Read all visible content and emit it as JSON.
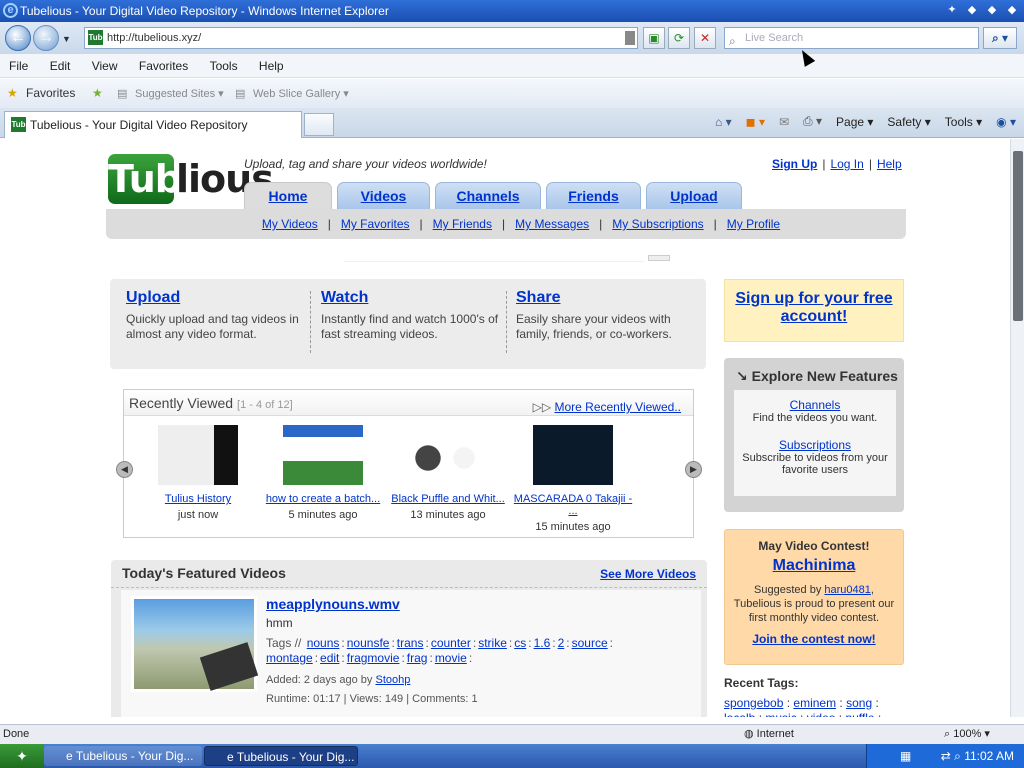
{
  "window": {
    "title": "Tubelious - Your Digital Video Repository - Windows Internet Explorer"
  },
  "browser": {
    "address": "http://tubelious.xyz/",
    "search_placeholder": "Live Search",
    "menu": [
      "File",
      "Edit",
      "View",
      "Favorites",
      "Tools",
      "Help"
    ],
    "favorites_bar": {
      "favorites": "Favorites",
      "suggested": "Suggested Sites ▾",
      "webslice": "Web Slice Gallery ▾"
    },
    "tab_title": "Tubelious - Your Digital Video Repository",
    "commands": {
      "page": "Page ▾",
      "safety": "Safety ▾",
      "tools": "Tools ▾"
    }
  },
  "site": {
    "logo_left": "Tube",
    "logo_right": "lious",
    "tagline": "Upload, tag and share your videos worldwide!",
    "toplinks": {
      "signup": "Sign Up",
      "login": "Log In",
      "help": "Help"
    },
    "tabs": [
      "Home",
      "Videos",
      "Channels",
      "Friends",
      "Upload"
    ],
    "subnav": [
      "My Videos",
      "My Favorites",
      "My Friends",
      "My Messages",
      "My Subscriptions",
      "My Profile"
    ]
  },
  "intro": [
    {
      "title": "Upload",
      "text": "Quickly upload and tag videos in almost any video format."
    },
    {
      "title": "Watch",
      "text": "Instantly find and watch 1000's of fast streaming videos."
    },
    {
      "title": "Share",
      "text": "Easily share your videos with family, friends, or co-workers."
    }
  ],
  "recent": {
    "title": "Recently Viewed",
    "count": "[1 - 4 of 12]",
    "more": "More Recently Viewed..",
    "items": [
      {
        "title": "Tulius History",
        "ago": "just now"
      },
      {
        "title": "how to create a batch...",
        "ago": "5 minutes ago"
      },
      {
        "title": "Black Puffle and Whit...",
        "ago": "13 minutes ago"
      },
      {
        "title": "MASCARADA 0 Takajii - ...",
        "ago": "15 minutes ago"
      }
    ]
  },
  "featured": {
    "title": "Today's Featured Videos",
    "see_more": "See More Videos",
    "video": {
      "title": "meapplynouns.wmv",
      "desc": "hmm",
      "tags_label": "Tags //",
      "tags": [
        "nouns",
        "nounsfe",
        "trans",
        "counter",
        "strike",
        "cs",
        "1.6",
        "2",
        "source",
        "montage",
        "edit",
        "fragmovie",
        "frag",
        "movie"
      ],
      "added_prefix": "Added: 2 days ago by",
      "author": "Stoohp",
      "stats": "Runtime: 01:17 | Views: 149 | Comments: 1"
    }
  },
  "sidebar": {
    "signup": "Sign up for your free account!",
    "explore_title": "Explore New Features",
    "explore": [
      {
        "link": "Channels",
        "text": "Find the videos you want."
      },
      {
        "link": "Subscriptions",
        "text": "Subscribe to videos from your favorite users"
      }
    ],
    "contest": {
      "heading": "May Video Contest!",
      "name": "Machinima",
      "suggested_prefix": "Suggested by",
      "user": "haru0481",
      "text": "Tubelious is proud to present our first monthly video contest.",
      "join": "Join the contest now!"
    },
    "tags_title": "Recent Tags:",
    "tags": [
      "spongebob",
      "eminem",
      "song",
      "localb",
      "music",
      "video",
      "puffle"
    ]
  },
  "status": {
    "left": "Done",
    "zone": "Internet",
    "zoom": "100% ▾"
  },
  "taskbar": {
    "item1": "Tubelious - Your Dig...",
    "item2": "Tubelious - Your Dig...",
    "clock": "11:02 AM"
  }
}
